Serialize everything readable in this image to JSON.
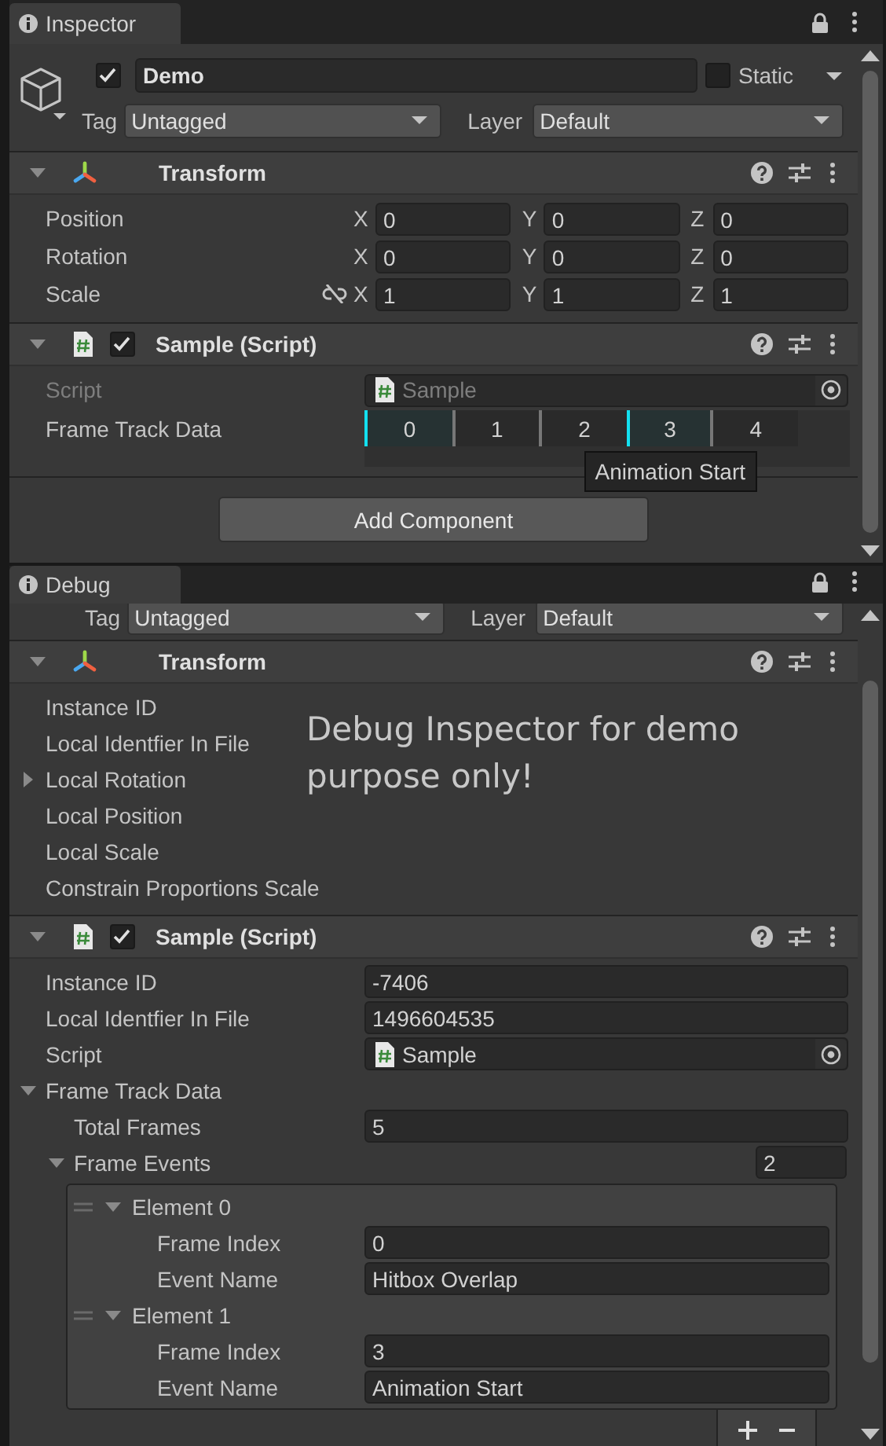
{
  "inspector": {
    "tab": "Inspector",
    "object": {
      "active": true,
      "name": "Demo",
      "static": false,
      "static_label": "Static",
      "tag_label": "Tag",
      "tag": "Untagged",
      "layer_label": "Layer",
      "layer": "Default"
    },
    "components": [
      {
        "kind": "transform",
        "title": "Transform",
        "expanded": true,
        "rows": [
          {
            "kind": "vector",
            "label": "Position",
            "axes": [
              {
                "axis": "X",
                "value": "0"
              },
              {
                "axis": "Y",
                "value": "0"
              },
              {
                "axis": "Z",
                "value": "0"
              }
            ]
          },
          {
            "kind": "vector",
            "label": "Rotation",
            "axes": [
              {
                "axis": "X",
                "value": "0"
              },
              {
                "axis": "Y",
                "value": "0"
              },
              {
                "axis": "Z",
                "value": "0"
              }
            ]
          },
          {
            "kind": "vector",
            "label": "Scale",
            "constrained": false,
            "axes": [
              {
                "axis": "X",
                "value": "1"
              },
              {
                "axis": "Y",
                "value": "1"
              },
              {
                "axis": "Z",
                "value": "1"
              }
            ]
          }
        ]
      },
      {
        "kind": "script",
        "title": "Sample (Script)",
        "enabled": true,
        "expanded": true,
        "rows": [
          {
            "kind": "object",
            "label": "Script",
            "value": "Sample",
            "disabled": true
          },
          {
            "kind": "frames",
            "label": "Frame Track Data",
            "frames": [
              {
                "label": "0",
                "event": true
              },
              {
                "label": "1",
                "event": false
              },
              {
                "label": "2",
                "event": false
              },
              {
                "label": "3",
                "event": true,
                "tooltip": "Animation Start"
              },
              {
                "label": "4",
                "event": false
              }
            ]
          }
        ]
      }
    ],
    "add_button": "Add Component"
  },
  "debug": {
    "tab": "Debug",
    "object": {
      "tag_label": "Tag",
      "tag": "Untagged",
      "layer_label": "Layer",
      "layer": "Default"
    },
    "components": [
      {
        "kind": "transform",
        "title": "Transform",
        "expanded": true,
        "note": "Debug Inspector for demo purpose only!",
        "rows": [
          {
            "kind": "label",
            "label": "Instance ID"
          },
          {
            "kind": "label",
            "label": "Local Identfier In File"
          },
          {
            "kind": "foldout",
            "label": "Local Rotation",
            "expanded": false
          },
          {
            "kind": "label",
            "label": "Local Position"
          },
          {
            "kind": "label",
            "label": "Local Scale"
          },
          {
            "kind": "label",
            "label": "Constrain Proportions Scale"
          }
        ]
      },
      {
        "kind": "script",
        "title": "Sample (Script)",
        "enabled": true,
        "expanded": true,
        "rows": [
          {
            "kind": "text",
            "label": "Instance ID",
            "value": "-7406"
          },
          {
            "kind": "text",
            "label": "Local Identfier In File",
            "value": "1496604535"
          },
          {
            "kind": "object",
            "label": "Script",
            "value": "Sample",
            "disabled": false
          },
          {
            "kind": "foldout",
            "label": "Frame Track Data",
            "expanded": true,
            "children": [
              {
                "kind": "text",
                "label": "Total Frames",
                "value": "5"
              },
              {
                "kind": "array",
                "label": "Frame Events",
                "expanded": true,
                "size": "2",
                "elements": [
                  {
                    "label": "Element 0",
                    "expanded": true,
                    "children": [
                      {
                        "kind": "text",
                        "label": "Frame Index",
                        "value": "0"
                      },
                      {
                        "kind": "text",
                        "label": "Event Name",
                        "value": "Hitbox Overlap"
                      }
                    ]
                  },
                  {
                    "label": "Element 1",
                    "expanded": true,
                    "children": [
                      {
                        "kind": "text",
                        "label": "Frame Index",
                        "value": "3"
                      },
                      {
                        "kind": "text",
                        "label": "Event Name",
                        "value": "Animation Start"
                      }
                    ]
                  }
                ]
              }
            ]
          }
        ]
      }
    ]
  }
}
